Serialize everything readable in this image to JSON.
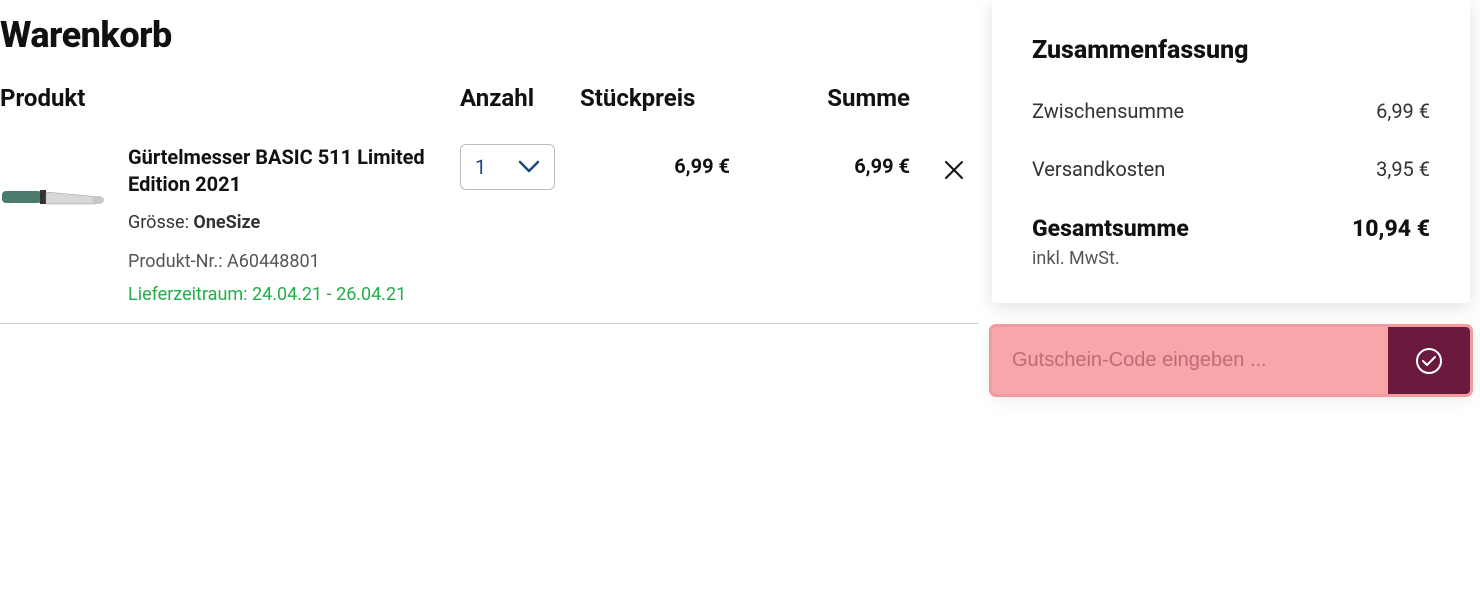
{
  "page": {
    "title": "Warenkorb"
  },
  "headers": {
    "product": "Produkt",
    "qty": "Anzahl",
    "unit_price": "Stückpreis",
    "sum": "Summe"
  },
  "items": [
    {
      "name": "Gürtelmesser BASIC 511 Limited Edition 2021",
      "size_label": "Grösse:",
      "size_value": "OneSize",
      "sku_label": "Produkt-Nr.:",
      "sku_value": "A60448801",
      "delivery": "Lieferzeitraum: 24.04.21 - 26.04.21",
      "qty": "1",
      "unit_price": "6,99 €",
      "sum": "6,99 €"
    }
  ],
  "summary": {
    "title": "Zusammenfassung",
    "subtotal_label": "Zwischensumme",
    "subtotal_value": "6,99 €",
    "shipping_label": "Versandkosten",
    "shipping_value": "3,95 €",
    "total_label": "Gesamtsumme",
    "total_value": "10,94 €",
    "tax_note": "inkl. MwSt."
  },
  "coupon": {
    "placeholder": "Gutschein-Code eingeben ..."
  }
}
